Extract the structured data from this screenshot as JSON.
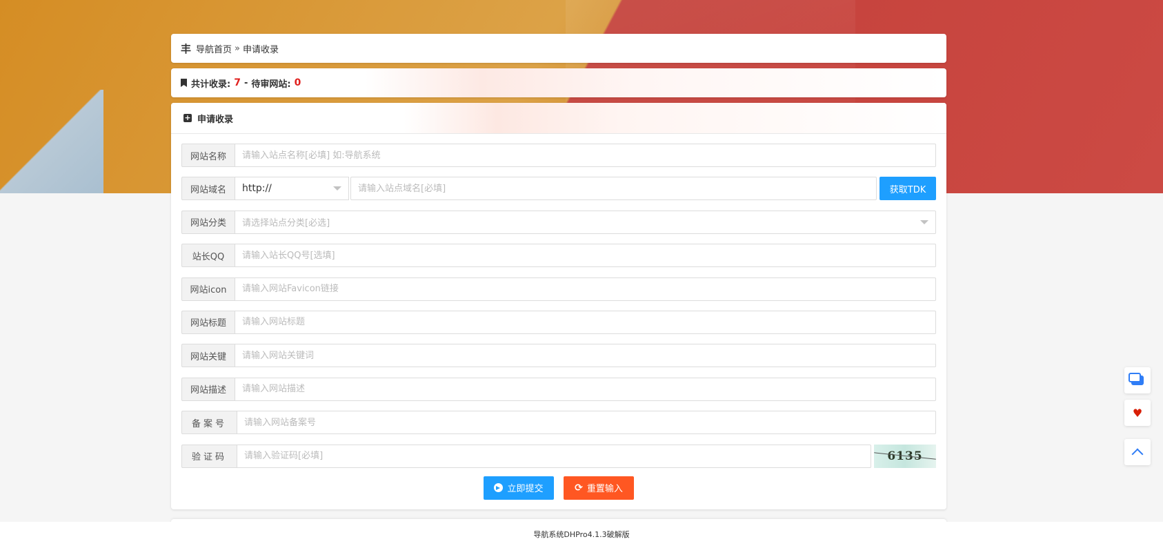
{
  "breadcrumb": {
    "home": "导航首页",
    "separator": "»",
    "current": "申请收录"
  },
  "stats": {
    "total_label": "共计收录:",
    "total_value": "7",
    "divider": "-",
    "pending_label": "待审网站:",
    "pending_value": "0"
  },
  "panel": {
    "title": "申请收录"
  },
  "form": {
    "name": {
      "label": "网站名称",
      "placeholder": "请输入站点名称[必填] 如:导航系统"
    },
    "domain": {
      "label": "网站域名",
      "protocol": "http://",
      "placeholder": "请输入站点域名[必填]",
      "tdk_button": "获取TDK"
    },
    "category": {
      "label": "网站分类",
      "placeholder": "请选择站点分类[必选]"
    },
    "qq": {
      "label": "站长QQ",
      "placeholder": "请输入站长QQ号[选填]"
    },
    "icon": {
      "label": "网站icon",
      "placeholder": "请输入网站Favicon链接"
    },
    "title": {
      "label": "网站标题",
      "placeholder": "请输入网站标题"
    },
    "keywords": {
      "label": "网站关键",
      "placeholder": "请输入网站关键词"
    },
    "description": {
      "label": "网站描述",
      "placeholder": "请输入网站描述"
    },
    "icp": {
      "label": "备案号",
      "placeholder": "请输入网站备案号"
    },
    "captcha": {
      "label": "验证码",
      "placeholder": "请输入验证码[必填]",
      "image_text": "6135"
    }
  },
  "actions": {
    "submit": "立即提交",
    "reset": "重置输入"
  },
  "footer": {
    "text": "导航系统DHPro4.1.3破解版"
  },
  "floating": {
    "chat_icon": "chat-icon",
    "heart_icon": "heart-icon",
    "top_icon": "chevron-up-icon"
  },
  "colors": {
    "primary": "#1e9fff",
    "danger": "#ff5722",
    "count": "#e0201e"
  }
}
